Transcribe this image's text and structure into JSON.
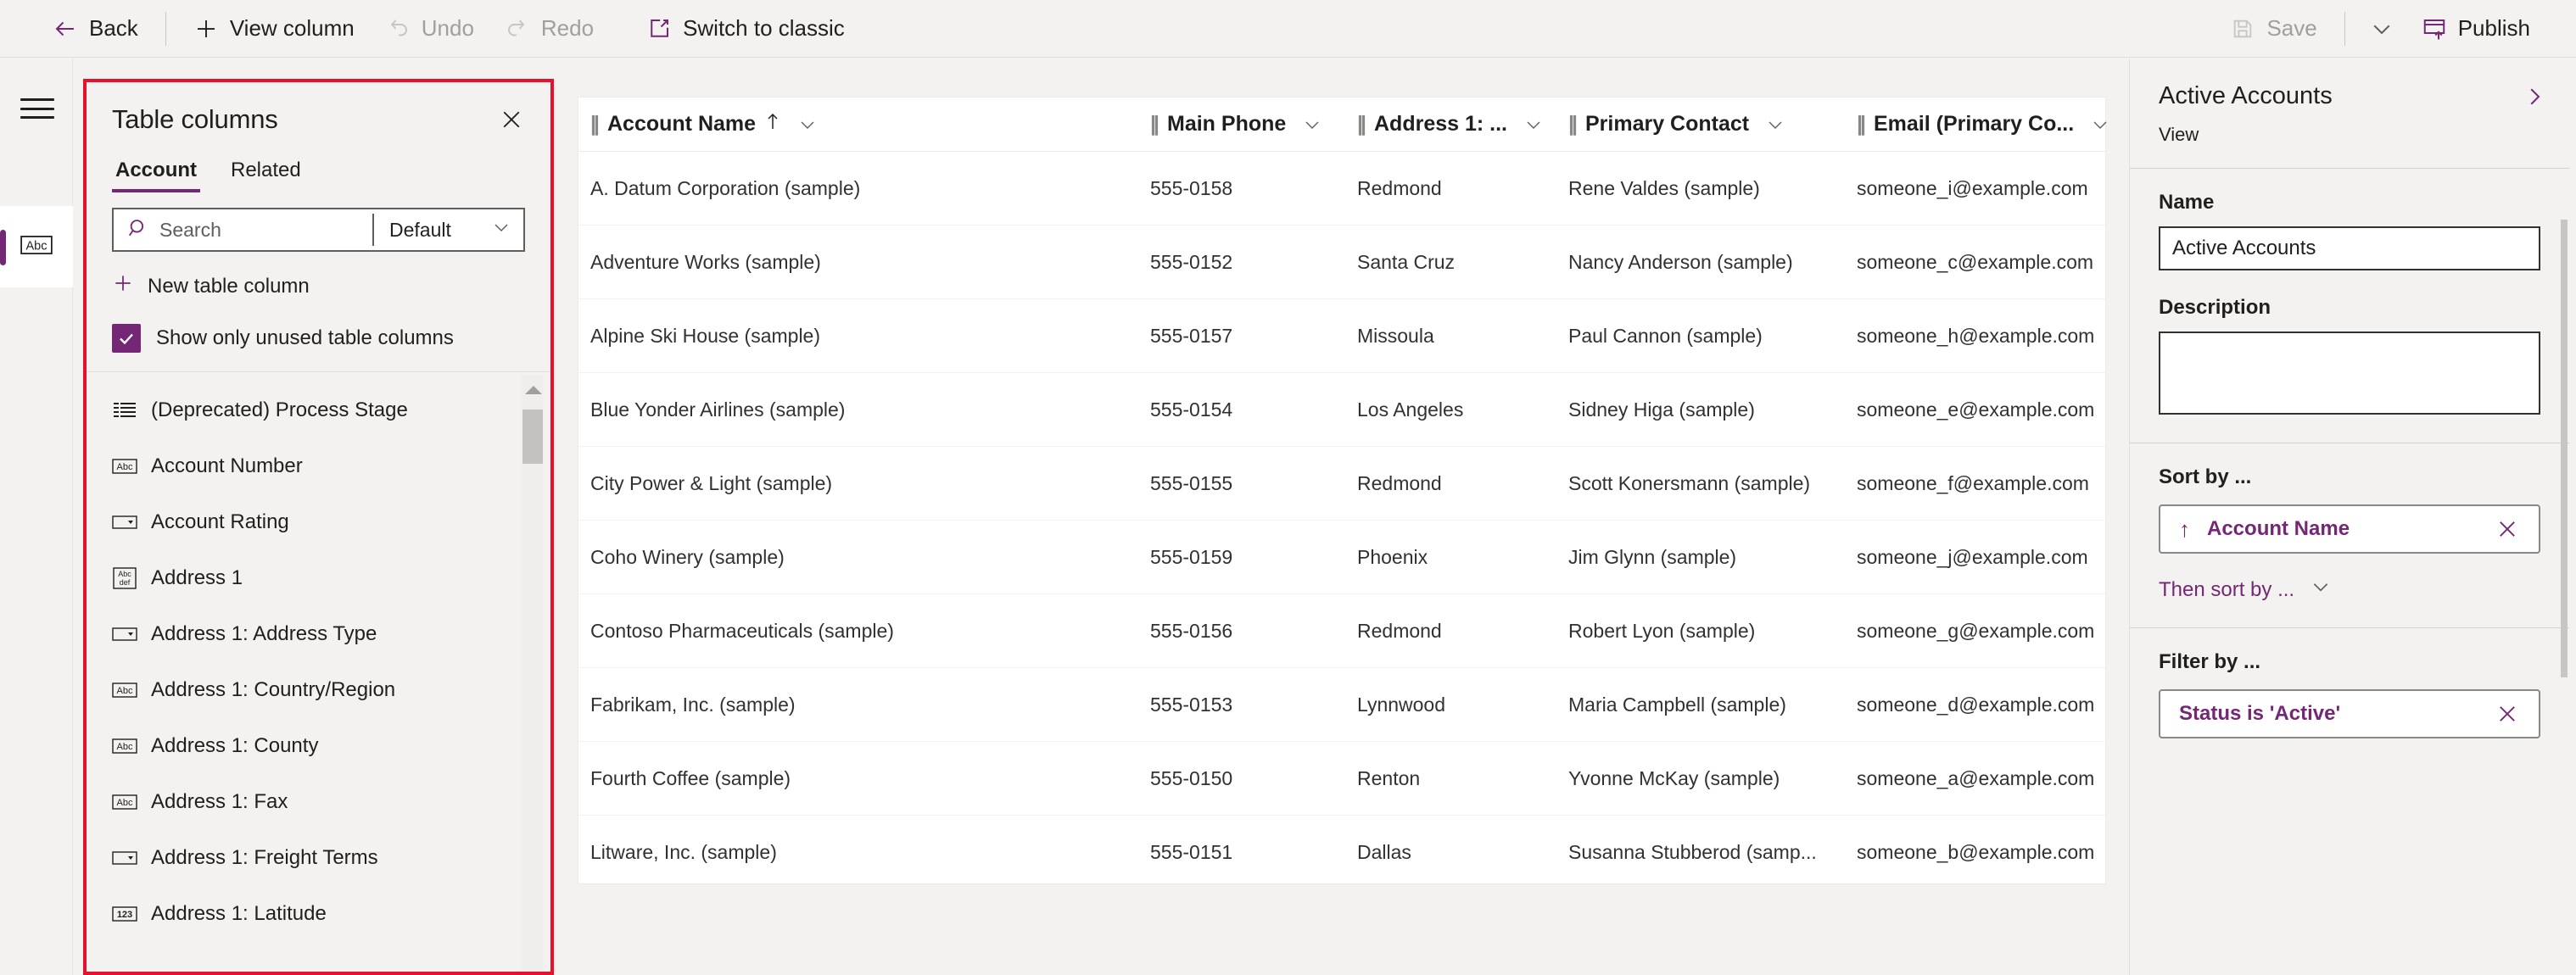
{
  "commandbar": {
    "back": "Back",
    "view_column": "View column",
    "undo": "Undo",
    "redo": "Redo",
    "switch_to_classic": "Switch to classic",
    "save": "Save",
    "publish": "Publish"
  },
  "flyout": {
    "title": "Table columns",
    "tabs": [
      {
        "label": "Account",
        "active": true
      },
      {
        "label": "Related",
        "active": false
      }
    ],
    "search_placeholder": "Search",
    "search_value": "",
    "filter_selected": "Default",
    "new_column": "New table column",
    "show_unused_label": "Show only unused table columns",
    "show_unused_checked": true,
    "columns": [
      {
        "name": "(Deprecated) Process Stage",
        "icon": "list-icon"
      },
      {
        "name": "Account Number",
        "icon": "text-abc-icon"
      },
      {
        "name": "Account Rating",
        "icon": "dropdown-icon"
      },
      {
        "name": "Address 1",
        "icon": "multiline-text-icon"
      },
      {
        "name": "Address 1: Address Type",
        "icon": "dropdown-icon"
      },
      {
        "name": "Address 1: Country/Region",
        "icon": "text-abc-icon"
      },
      {
        "name": "Address 1: County",
        "icon": "text-abc-icon"
      },
      {
        "name": "Address 1: Fax",
        "icon": "text-abc-icon"
      },
      {
        "name": "Address 1: Freight Terms",
        "icon": "dropdown-icon"
      },
      {
        "name": "Address 1: Latitude",
        "icon": "number-123-icon"
      }
    ]
  },
  "grid": {
    "headers": [
      {
        "label": "Account Name",
        "sorted": true,
        "sort_dir": "asc"
      },
      {
        "label": "Main Phone",
        "sorted": false
      },
      {
        "label": "Address 1: ...",
        "sorted": false
      },
      {
        "label": "Primary Contact",
        "sorted": false
      },
      {
        "label": "Email (Primary Co...",
        "sorted": false
      }
    ],
    "rows": [
      [
        "A. Datum Corporation (sample)",
        "555-0158",
        "Redmond",
        "Rene Valdes (sample)",
        "someone_i@example.com"
      ],
      [
        "Adventure Works (sample)",
        "555-0152",
        "Santa Cruz",
        "Nancy Anderson (sample)",
        "someone_c@example.com"
      ],
      [
        "Alpine Ski House (sample)",
        "555-0157",
        "Missoula",
        "Paul Cannon (sample)",
        "someone_h@example.com"
      ],
      [
        "Blue Yonder Airlines (sample)",
        "555-0154",
        "Los Angeles",
        "Sidney Higa (sample)",
        "someone_e@example.com"
      ],
      [
        "City Power & Light (sample)",
        "555-0155",
        "Redmond",
        "Scott Konersmann (sample)",
        "someone_f@example.com"
      ],
      [
        "Coho Winery (sample)",
        "555-0159",
        "Phoenix",
        "Jim Glynn (sample)",
        "someone_j@example.com"
      ],
      [
        "Contoso Pharmaceuticals (sample)",
        "555-0156",
        "Redmond",
        "Robert Lyon (sample)",
        "someone_g@example.com"
      ],
      [
        "Fabrikam, Inc. (sample)",
        "555-0153",
        "Lynnwood",
        "Maria Campbell (sample)",
        "someone_d@example.com"
      ],
      [
        "Fourth Coffee (sample)",
        "555-0150",
        "Renton",
        "Yvonne McKay (sample)",
        "someone_a@example.com"
      ],
      [
        "Litware, Inc. (sample)",
        "555-0151",
        "Dallas",
        "Susanna Stubberod (samp...",
        "someone_b@example.com"
      ]
    ]
  },
  "properties": {
    "title": "Active Accounts",
    "subtitle": "View",
    "name_label": "Name",
    "name_value": "Active Accounts",
    "description_label": "Description",
    "description_value": "",
    "sort_by_label": "Sort by ...",
    "sort_chip": "Account Name",
    "sort_chip_direction": "↑",
    "then_sort_by": "Then sort by ...",
    "filter_by_label": "Filter by ...",
    "filter_chip": "Status is 'Active'"
  },
  "colors": {
    "accent": "#742774",
    "highlight": "#e8112d",
    "app_bg": "#f3f2f1",
    "grid_bg": "#ffffff",
    "text": "#201f1e",
    "disabled": "#a19f9d"
  }
}
